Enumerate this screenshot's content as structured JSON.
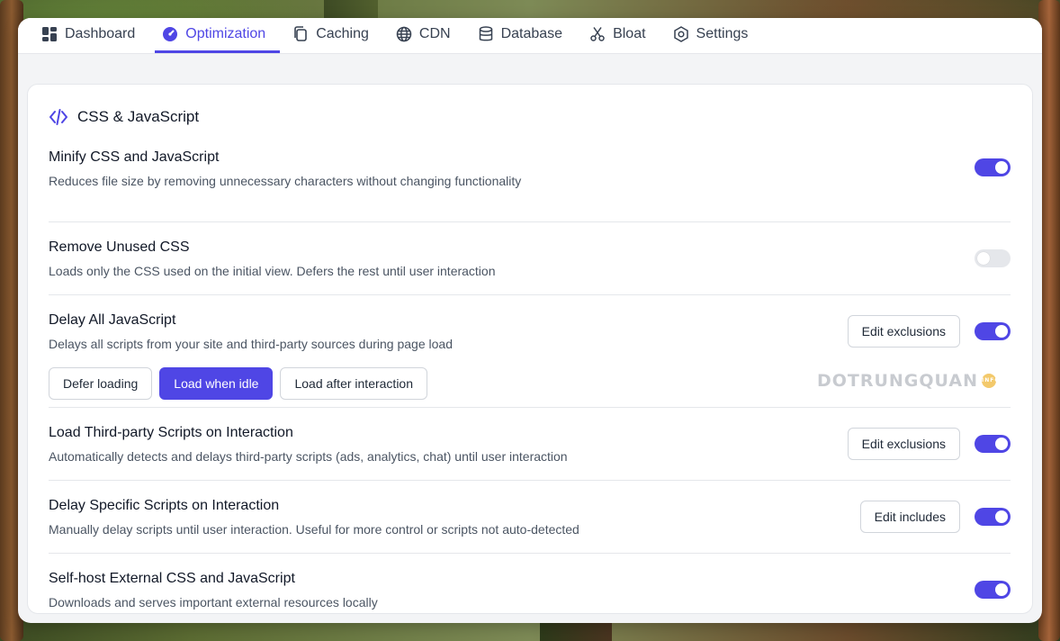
{
  "tabs": [
    {
      "label": "Dashboard",
      "icon": "grid-icon"
    },
    {
      "label": "Optimization",
      "icon": "gauge-icon",
      "active": true
    },
    {
      "label": "Caching",
      "icon": "copy-icon"
    },
    {
      "label": "CDN",
      "icon": "globe-icon"
    },
    {
      "label": "Database",
      "icon": "database-icon"
    },
    {
      "label": "Bloat",
      "icon": "scissors-icon"
    },
    {
      "label": "Settings",
      "icon": "settings-icon"
    }
  ],
  "section": {
    "title": "CSS & JavaScript",
    "icon": "code-icon"
  },
  "settings": [
    {
      "title": "Minify CSS and JavaScript",
      "description": "Reduces file size by removing unnecessary characters without changing functionality",
      "enabled": true
    },
    {
      "title": "Remove Unused CSS",
      "description": "Loads only the CSS used on the initial view. Defers the rest until user interaction",
      "enabled": false
    },
    {
      "title": "Delay All JavaScript",
      "description": "Delays all scripts from your site and third-party sources during page load",
      "button": "Edit exclusions",
      "enabled": true,
      "modes": [
        "Defer loading",
        "Load when idle",
        "Load after interaction"
      ],
      "selected_mode": "Load when idle"
    },
    {
      "title": "Load Third-party Scripts on Interaction",
      "description": "Automatically detects and delays third-party scripts (ads, analytics, chat) until user interaction",
      "button": "Edit exclusions",
      "enabled": true
    },
    {
      "title": "Delay Specific Scripts on Interaction",
      "description": "Manually delay scripts until user interaction. Useful for more control or scripts not auto-detected",
      "button": "Edit includes",
      "enabled": true
    },
    {
      "title": "Self-host External CSS and JavaScript",
      "description": "Downloads and serves important external resources locally",
      "enabled": true
    }
  ],
  "watermark": {
    "text": "DOTRUNGQUAN",
    "badge": "INFO"
  },
  "colors": {
    "accent": "#4f46e5",
    "toggle_off": "#e5e7eb"
  }
}
